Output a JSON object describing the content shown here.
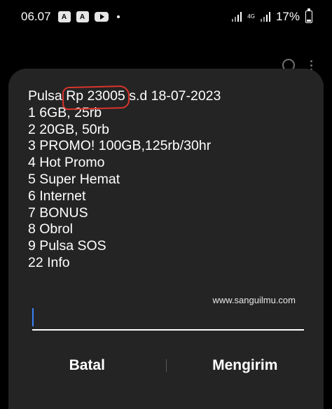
{
  "status_bar": {
    "time": "06.07",
    "network": "4G",
    "battery": "17%"
  },
  "dialog": {
    "lines": [
      {
        "before": "Pulsa ",
        "highlight": "Rp 23005",
        "after": " s.d 18-07-2023"
      },
      {
        "text": "1 6GB, 25rb"
      },
      {
        "text": "2 20GB, 50rb"
      },
      {
        "text": "3 PROMO! 100GB,125rb/30hr"
      },
      {
        "text": "4 Hot Promo"
      },
      {
        "text": "5 Super Hemat"
      },
      {
        "text": "6 Internet"
      },
      {
        "text": "7 BONUS"
      },
      {
        "text": "8 Obrol"
      },
      {
        "text": "9 Pulsa SOS"
      },
      {
        "text": "22 Info"
      }
    ],
    "watermark": "www.sanguilmu.com",
    "input_value": "",
    "cancel_label": "Batal",
    "send_label": "Mengirim"
  },
  "colors": {
    "dialog_bg": "#242424",
    "highlight_circle": "#d9342b",
    "caret": "#3b82f6"
  }
}
